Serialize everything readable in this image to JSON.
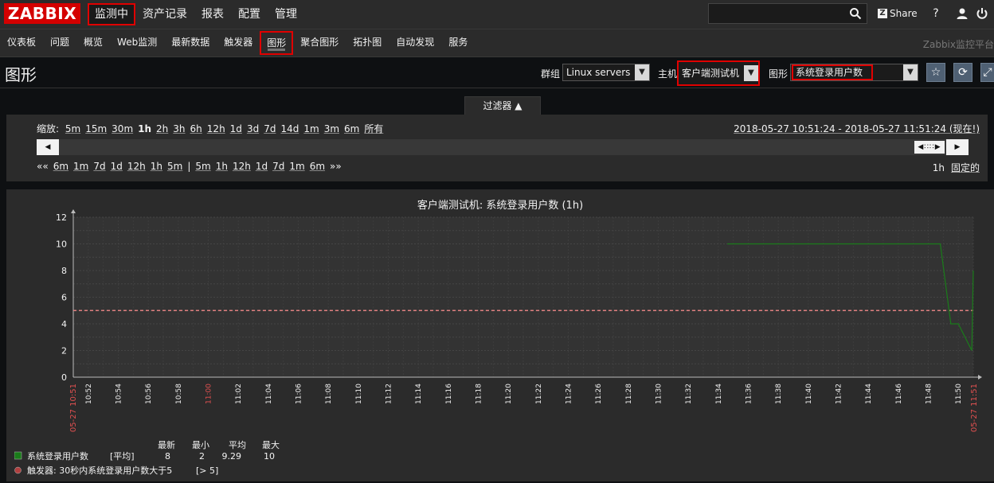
{
  "logo": {
    "text": "ZABBIX"
  },
  "main_menu": [
    {
      "label": "监测中",
      "active": true
    },
    {
      "label": "资产记录",
      "active": false
    },
    {
      "label": "报表",
      "active": false
    },
    {
      "label": "配置",
      "active": false
    },
    {
      "label": "管理",
      "active": false
    }
  ],
  "top_right": {
    "search_placeholder": "",
    "share_label": "Share",
    "help": "?"
  },
  "sub_menu": [
    {
      "label": "仪表板",
      "active": false
    },
    {
      "label": "问题",
      "active": false
    },
    {
      "label": "概览",
      "active": false
    },
    {
      "label": "Web监测",
      "active": false
    },
    {
      "label": "最新数据",
      "active": false
    },
    {
      "label": "触发器",
      "active": false
    },
    {
      "label": "图形",
      "active": true
    },
    {
      "label": "聚合图形",
      "active": false
    },
    {
      "label": "拓扑图",
      "active": false
    },
    {
      "label": "自动发现",
      "active": false
    },
    {
      "label": "服务",
      "active": false
    }
  ],
  "brand_text": "Zabbix监控平台",
  "header": {
    "title": "图形",
    "group_label": "群组",
    "group_value": "Linux servers",
    "host_label": "主机",
    "host_value": "客户端测试机",
    "graph_label": "图形",
    "graph_value": "系统登录用户数"
  },
  "filter": {
    "tab_label": "过滤器 ▲",
    "zoom_label": "缩放:",
    "zoom_options": [
      "5m",
      "15m",
      "30m",
      "1h",
      "2h",
      "3h",
      "6h",
      "12h",
      "1d",
      "3d",
      "7d",
      "14d",
      "1m",
      "3m",
      "6m",
      "所有"
    ],
    "zoom_selected": "1h",
    "date_range": "2018-05-27 10:51:24 - 2018-05-27 11:51:24 (现在!)",
    "nav_back_prefix": "««",
    "nav_back": [
      "6m",
      "1m",
      "7d",
      "1d",
      "12h",
      "1h",
      "5m"
    ],
    "nav_separator": "|",
    "nav_forward": [
      "5m",
      "1h",
      "12h",
      "1d",
      "7d",
      "1m",
      "6m"
    ],
    "nav_forward_suffix": "»»",
    "period": "1h",
    "fixed_label": "固定的",
    "scroll_left": "◀",
    "scroll_right": "▶",
    "scroll_thumb": "◀∷∷▶"
  },
  "chart_data": {
    "type": "line",
    "title": "客户端测试机: 系统登录用户数 (1h)",
    "ylim": [
      0,
      12
    ],
    "y_ticks": [
      0,
      2,
      4,
      6,
      8,
      10,
      12
    ],
    "x_tick_labels": [
      "10:52",
      "10:54",
      "10:56",
      "10:58",
      "11:00",
      "11:02",
      "11:04",
      "11:06",
      "11:08",
      "11:10",
      "11:12",
      "11:14",
      "11:16",
      "11:18",
      "11:20",
      "11:22",
      "11:24",
      "11:26",
      "11:28",
      "11:30",
      "11:32",
      "11:34",
      "11:36",
      "11:38",
      "11:40",
      "11:42",
      "11:44",
      "11:46",
      "11:48",
      "11:50"
    ],
    "x_red_ticks": [
      "11:00"
    ],
    "x_start_label": "05-27 10:51",
    "x_end_label": "05-27 11:51",
    "x_range_minutes": [
      0,
      60
    ],
    "series": [
      {
        "name": "系统登录用户数",
        "color": "#1a7c1a",
        "points": [
          [
            43.6,
            10
          ],
          [
            57.8,
            10
          ],
          [
            58.5,
            4
          ],
          [
            59.0,
            4
          ],
          [
            59.9,
            2
          ],
          [
            60.6,
            8
          ],
          [
            61.5,
            8
          ]
        ]
      }
    ],
    "trigger_line": {
      "value": 5,
      "color": "#e08080"
    },
    "grid": true
  },
  "legend": {
    "headers": [
      "最新",
      "最小",
      "平均",
      "最大"
    ],
    "series_name": "系统登录用户数",
    "series_func": "[平均]",
    "values": [
      "8",
      "2",
      "9.29",
      "10"
    ],
    "series_color": "#1a7c1a",
    "trigger_text": "触发器: 30秒内系统登录用户数大于5",
    "trigger_cond": "[> 5]",
    "trigger_color": "#b04040"
  }
}
